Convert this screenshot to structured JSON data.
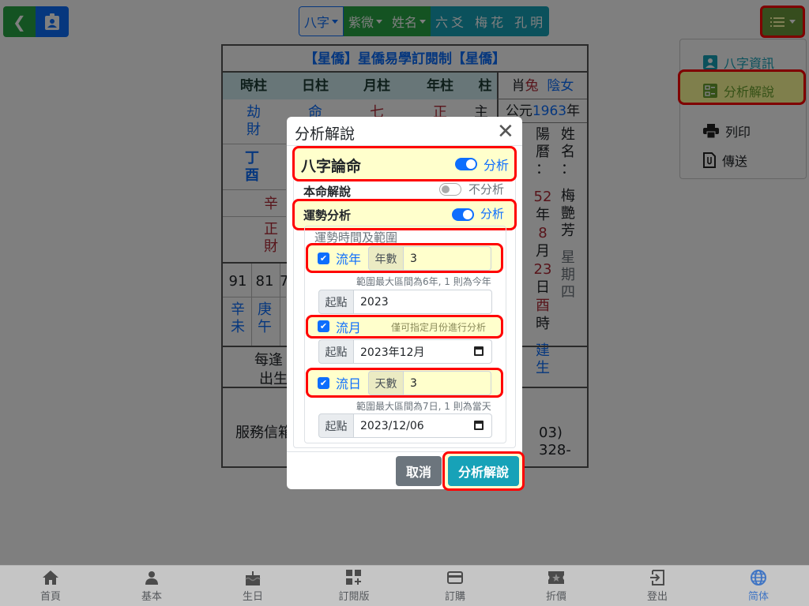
{
  "topbar": {
    "back_icon": "chevron-left-icon",
    "profile_icon": "badge-icon",
    "tabs": [
      {
        "label": "八字",
        "dropdown": true
      },
      {
        "label": "紫微",
        "dropdown": true
      },
      {
        "label": "姓名",
        "dropdown": true
      },
      {
        "label": "六爻",
        "dropdown": false
      },
      {
        "label": "梅花",
        "dropdown": false
      },
      {
        "label": "孔明",
        "dropdown": false
      }
    ],
    "menu_icon": "list-icon"
  },
  "dropdown": {
    "items": [
      {
        "label": "八字資訊",
        "icon": "person-badge-icon"
      },
      {
        "label": "分析解說",
        "icon": "list-check-icon"
      },
      {
        "label": "列印",
        "icon": "printer-icon"
      },
      {
        "label": "傳送",
        "icon": "paperclip-icon"
      }
    ]
  },
  "chart": {
    "title": "【星僑】星僑易學訂閱制【星僑】",
    "pillar_headers": [
      "時柱",
      "日柱",
      "月柱",
      "年柱",
      "柱"
    ],
    "row_tenGods": [
      "劫財",
      "命",
      "七",
      "正",
      "主"
    ],
    "hour_stem_branch": "丁酉",
    "hidden_stem": "辛",
    "hidden_god": "正財",
    "zodiac_label": "肖",
    "zodiac": "兔",
    "gender": "陰女",
    "year_prefix": "公元",
    "year": "1963",
    "year_suffix": "年",
    "solar_label": "陽曆：",
    "solar_year": "52",
    "solar_year_unit": "年",
    "solar_month": "8",
    "solar_month_unit": "月",
    "solar_day": "23",
    "solar_day_unit": "日",
    "solar_hour": "酉",
    "solar_hour_unit": "時",
    "solar_extra": "建生",
    "name_label": "姓名：",
    "name": "梅艷芳",
    "weekday": "星期四",
    "luck_ages": [
      "91",
      "81",
      "7"
    ],
    "luck_pillars": [
      "辛未",
      "庚午"
    ],
    "note_line1": "每逢",
    "note_line2": "出生",
    "service": "服務信箱",
    "phone_fragment": "03) 328-"
  },
  "modal": {
    "title": "分析解說",
    "close_icon": "close-icon",
    "bazi": {
      "label": "八字論命",
      "toggle_on": true,
      "state": "分析"
    },
    "natal": {
      "label": "本命解說",
      "toggle_on": false,
      "state": "不分析"
    },
    "luck": {
      "label": "運勢分析",
      "toggle_on": true,
      "state": "分析"
    },
    "range_title": "運勢時間及範圍",
    "year": {
      "label": "流年",
      "checked": true,
      "count_label": "年數",
      "count": "3",
      "hint": "範圍最大區間為6年, 1 則為今年",
      "start_label": "起點",
      "start": "2023"
    },
    "month": {
      "label": "流月",
      "checked": true,
      "hint": "僅可指定月份進行分析",
      "start_label": "起點",
      "start": "2023年12月"
    },
    "day": {
      "label": "流日",
      "checked": true,
      "count_label": "天數",
      "count": "3",
      "hint": "範圍最大區間為7日, 1 則為當天",
      "start_label": "起點",
      "start": "2023/12/06"
    },
    "cancel": "取消",
    "submit": "分析解說"
  },
  "bottom_nav": [
    {
      "label": "首頁",
      "icon": "home-icon"
    },
    {
      "label": "基本",
      "icon": "person-icon"
    },
    {
      "label": "生日",
      "icon": "cake-icon"
    },
    {
      "label": "訂閱版",
      "icon": "grid-plus-icon"
    },
    {
      "label": "訂購",
      "icon": "credit-card-icon"
    },
    {
      "label": "折價",
      "icon": "ticket-star-icon"
    },
    {
      "label": "登出",
      "icon": "logout-icon"
    },
    {
      "label": "简体",
      "icon": "globe-icon",
      "active": true
    }
  ]
}
